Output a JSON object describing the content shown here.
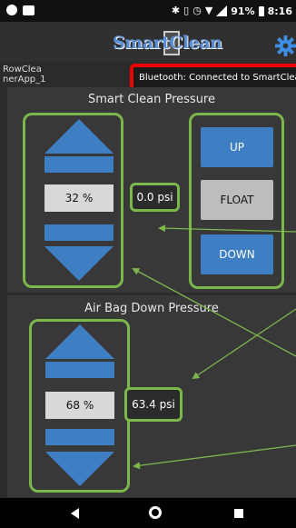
{
  "status_bar": {
    "battery": "91%",
    "time": "8:16"
  },
  "app": {
    "logo_text": "SmartClean",
    "app_name": "RowClea nerApp_1",
    "bluetooth_status": "Bluetooth: Connected to SmartClean"
  },
  "smart_clean": {
    "title": "Smart Clean Pressure",
    "percent": "32 %",
    "psi": "0.0 psi",
    "buttons": {
      "up": "UP",
      "float": "FLOAT",
      "down": "DOWN"
    }
  },
  "air_bag": {
    "title": "Air Bag Down Pressure",
    "percent": "68 %",
    "psi": "63.4 psi"
  },
  "colors": {
    "accent_blue": "#3e7ec2",
    "highlight_green": "#7cb74c",
    "alert_red": "#e00000"
  },
  "icons": [
    "gear-icon",
    "up-arrow-icon",
    "down-arrow-icon",
    "back-icon",
    "home-icon",
    "recents-icon"
  ]
}
